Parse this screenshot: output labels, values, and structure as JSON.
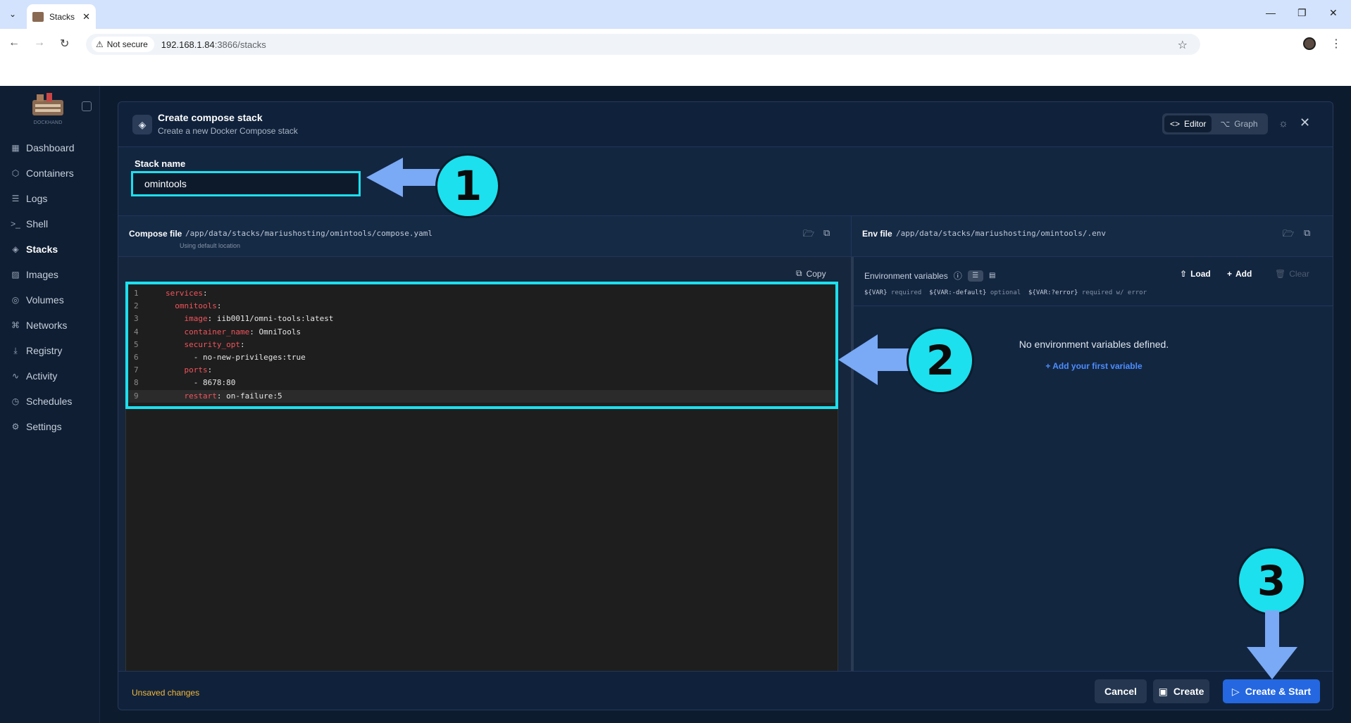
{
  "browser": {
    "tab_title": "Stacks",
    "security_label": "Not secure",
    "url_host": "192.168.1.84",
    "url_rest": ":3866/stacks"
  },
  "sidebar": {
    "logo_text": "DOCKHAND",
    "items": [
      {
        "label": "Dashboard",
        "icon": "grid-icon"
      },
      {
        "label": "Containers",
        "icon": "box-icon"
      },
      {
        "label": "Logs",
        "icon": "logs-icon"
      },
      {
        "label": "Shell",
        "icon": "terminal-icon"
      },
      {
        "label": "Stacks",
        "icon": "layers-icon"
      },
      {
        "label": "Images",
        "icon": "image-icon"
      },
      {
        "label": "Volumes",
        "icon": "database-icon"
      },
      {
        "label": "Networks",
        "icon": "network-icon"
      },
      {
        "label": "Registry",
        "icon": "download-icon"
      },
      {
        "label": "Activity",
        "icon": "activity-icon"
      },
      {
        "label": "Schedules",
        "icon": "clock-icon"
      },
      {
        "label": "Settings",
        "icon": "gear-icon"
      }
    ],
    "active": "Stacks"
  },
  "modal": {
    "title": "Create compose stack",
    "subtitle": "Create a new Docker Compose stack",
    "view_editor": "Editor",
    "view_graph": "Graph",
    "stack_name_label": "Stack name",
    "stack_name_value": "omintools",
    "compose_label": "Compose file",
    "compose_path": "/app/data/stacks/mariushosting/omintools/compose.yaml",
    "compose_note": "Using default location",
    "env_label": "Env file",
    "env_path": "/app/data/stacks/mariushosting/omintools/.env",
    "copy_label": "Copy",
    "code_lines": [
      {
        "n": "1",
        "key": "services",
        "rest": ":",
        "indent": ""
      },
      {
        "n": "2",
        "key": "omnitools",
        "rest": ":",
        "indent": "  "
      },
      {
        "n": "3",
        "key": "image",
        "rest": ": iib0011/omni-tools:latest",
        "indent": "    "
      },
      {
        "n": "4",
        "key": "container_name",
        "rest": ": OmniTools",
        "indent": "    "
      },
      {
        "n": "5",
        "key": "security_opt",
        "rest": ":",
        "indent": "    "
      },
      {
        "n": "6",
        "key": "",
        "rest": "- no-new-privileges:true",
        "indent": "      "
      },
      {
        "n": "7",
        "key": "ports",
        "rest": ":",
        "indent": "    "
      },
      {
        "n": "8",
        "key": "",
        "rest": "- 8678:80",
        "indent": "      "
      },
      {
        "n": "9",
        "key": "restart",
        "rest": ": on-failure:5",
        "indent": "    "
      }
    ],
    "env_title": "Environment variables",
    "env_load": "Load",
    "env_add": "Add",
    "env_clear": "Clear",
    "env_hint_1": "${VAR}",
    "env_hint_1b": " required  ",
    "env_hint_2": "${VAR:-default}",
    "env_hint_2b": " optional  ",
    "env_hint_3": "${VAR:?error}",
    "env_hint_3b": " required w/ error",
    "env_empty": "No environment variables defined.",
    "env_add_first": "Add your first variable",
    "unsaved": "Unsaved changes",
    "cancel": "Cancel",
    "create": "Create",
    "create_start": "Create & Start"
  },
  "annotations": [
    "1",
    "2",
    "3"
  ],
  "colors": {
    "highlight": "#1ce0ee",
    "arrow": "#7aa9f5",
    "accent": "#2467e0"
  }
}
